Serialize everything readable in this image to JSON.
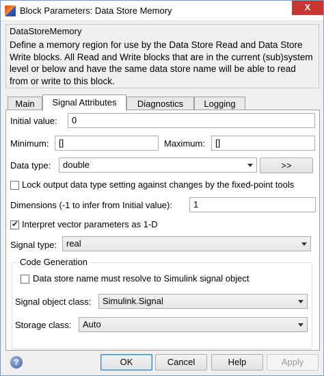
{
  "window": {
    "title": "Block Parameters: Data Store Memory",
    "close_glyph": "X"
  },
  "description": {
    "block_name": "DataStoreMemory",
    "text": "Define a memory region for use by the Data Store Read and Data Store Write blocks. All Read and Write blocks that are in the current (sub)system level or below and have the same data store name will be able to read from or write to this block."
  },
  "tabs": [
    {
      "label": "Main",
      "active": false
    },
    {
      "label": "Signal Attributes",
      "active": true
    },
    {
      "label": "Diagnostics",
      "active": false
    },
    {
      "label": "Logging",
      "active": false
    }
  ],
  "signal_attributes": {
    "initial_value_label": "Initial value:",
    "initial_value": "0",
    "minimum_label": "Minimum:",
    "minimum_value": "[]",
    "maximum_label": "Maximum:",
    "maximum_value": "[]",
    "data_type_label": "Data type:",
    "data_type_value": "double",
    "assistant_button": ">>",
    "lock_label": "Lock output data type setting against changes by the fixed-point tools",
    "lock_checked": false,
    "dimensions_label": "Dimensions (-1 to infer from Initial value):",
    "dimensions_value": "1",
    "interpret_label": "Interpret vector parameters as 1-D",
    "interpret_checked": true,
    "signal_type_label": "Signal type:",
    "signal_type_value": "real"
  },
  "code_generation": {
    "group_title": "Code Generation",
    "resolve_label": "Data store name must resolve to Simulink signal object",
    "resolve_checked": false,
    "signal_object_class_label": "Signal object class:",
    "signal_object_class_value": "Simulink.Signal",
    "storage_class_label": "Storage class:",
    "storage_class_value": "Auto"
  },
  "buttons": {
    "ok": "OK",
    "cancel": "Cancel",
    "help": "Help",
    "apply": "Apply",
    "help_icon_glyph": "?"
  },
  "colors": {
    "title_close_red": "#c7372f",
    "window_bg": "#f0f0f0",
    "default_button_border": "#3c7fb1"
  }
}
